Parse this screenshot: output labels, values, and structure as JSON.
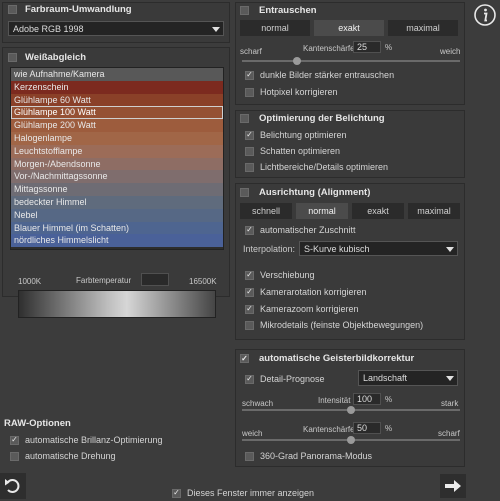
{
  "color_space": {
    "title": "Farbraum-Umwandlung",
    "selected": "Adobe RGB 1998"
  },
  "white_balance": {
    "title": "Weißabgleich",
    "items": [
      {
        "label": "wie Aufnahme/Kamera",
        "color": "#585858"
      },
      {
        "label": "Kerzenschein",
        "color": "#7c2a1f"
      },
      {
        "label": "Glühlampe 60 Watt",
        "color": "#8a4028"
      },
      {
        "label": "Glühlampe 100 Watt",
        "color": "#955134"
      },
      {
        "label": "Glühlampe 200 Watt",
        "color": "#9d5c3d"
      },
      {
        "label": "Halogenlampe",
        "color": "#a16647"
      },
      {
        "label": "Leuchtstofflampe",
        "color": "#9c6c58"
      },
      {
        "label": "Morgen-/Abendsonne",
        "color": "#8e6d64"
      },
      {
        "label": "Vor-/Nachmittagssonne",
        "color": "#7f6d6d"
      },
      {
        "label": "Mittagssonne",
        "color": "#6e6c74"
      },
      {
        "label": "bedeckter Himmel",
        "color": "#5f6b7d"
      },
      {
        "label": "Nebel",
        "color": "#566885"
      },
      {
        "label": "Blauer Himmel (im Schatten)",
        "color": "#4e6590"
      },
      {
        "label": "nördliches Himmelslicht",
        "color": "#4a6199"
      }
    ],
    "selected_index": 3,
    "temp_label": "Farbtemperatur",
    "temp_min": "1000K",
    "temp_max": "16500K"
  },
  "raw": {
    "title": "RAW-Optionen",
    "auto_brilliance": {
      "label": "automatische Brillanz-Optimierung",
      "checked": true
    },
    "auto_rotate": {
      "label": "automatische Drehung",
      "checked": false
    }
  },
  "denoise": {
    "title": "Entrauschen",
    "modes": [
      "normal",
      "exakt",
      "maximal"
    ],
    "selected_mode": 1,
    "sharp_label": "scharf",
    "soft_label": "weich",
    "edge_label": "Kantenschärfe",
    "edge_value": "25",
    "edge_unit": "%",
    "edge_fraction": 0.25,
    "dark_images": {
      "label": "dunkle Bilder stärker entrauschen",
      "checked": true
    },
    "hotpixel": {
      "label": "Hotpixel korrigieren",
      "checked": false
    }
  },
  "exposure": {
    "title": "Optimierung der Belichtung",
    "optimize_exposure": {
      "label": "Belichtung optimieren",
      "checked": true
    },
    "optimize_shadows": {
      "label": "Schatten optimieren",
      "checked": false
    },
    "optimize_highlights": {
      "label": "Lichtbereiche/Details optimieren",
      "checked": false
    }
  },
  "alignment": {
    "title": "Ausrichtung (Alignment)",
    "modes": [
      "schnell",
      "normal",
      "exakt",
      "maximal"
    ],
    "selected_mode": 1,
    "auto_crop": {
      "label": "automatischer Zuschnitt",
      "checked": true
    },
    "interp_label": "Interpolation:",
    "interp_value": "S-Kurve kubisch",
    "shift": {
      "label": "Verschiebung",
      "checked": true
    },
    "rotation": {
      "label": "Kamerarotation korrigieren",
      "checked": true
    },
    "zoom": {
      "label": "Kamerazoom korrigieren",
      "checked": true
    },
    "micro": {
      "label": "Mikrodetails (feinste Objektbewegungen)",
      "checked": false
    }
  },
  "ghost": {
    "title": "automatische Geisterbildkorrektur",
    "detail": {
      "label": "Detail-Prognose",
      "checked": true
    },
    "preset": "Landschaft",
    "weak_label": "schwach",
    "strong_label": "stark",
    "intensity_label": "Intensität",
    "intensity_value": "100",
    "intensity_unit": "%",
    "intensity_fraction": 0.5,
    "soft_label": "weich",
    "sharp_label": "scharf",
    "edge_label": "Kantenschärfe",
    "edge_value": "50",
    "edge_unit": "%",
    "edge_fraction": 0.5,
    "panorama": {
      "label": "360-Grad Panorama-Modus",
      "checked": false
    }
  },
  "footer": {
    "always_show": {
      "label": "Dieses Fenster immer anzeigen",
      "checked": true
    }
  },
  "icons": {
    "info": "info-icon",
    "back": "undo-arrow-icon",
    "next": "right-arrow-icon"
  }
}
